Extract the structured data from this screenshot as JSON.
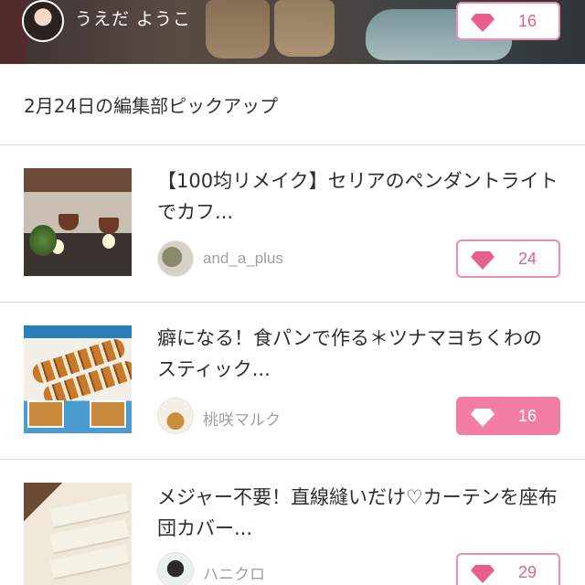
{
  "header": {
    "user_name": "うえだ ようこ",
    "likes": "16"
  },
  "section": {
    "heading": "2月24日の編集部ピックアップ"
  },
  "articles": [
    {
      "title": "【100均リメイク】セリアのペンダントライトでカフ...",
      "author": "and_a_plus",
      "likes": "24",
      "liked": false
    },
    {
      "title": "癖になる！食パンで作る＊ツナマヨちくわのスティック...",
      "author": "桃咲マルク",
      "likes": "16",
      "liked": true
    },
    {
      "title": "メジャー不要！直線縫いだけ♡カーテンを座布団カバー...",
      "author": "ハニクロ",
      "likes": "29",
      "liked": false
    }
  ],
  "colors": {
    "accent": "#f27ea3",
    "accent_text": "#e75f8c",
    "divider": "#dcdcdc"
  },
  "icons": {
    "like": "diamond-icon"
  }
}
